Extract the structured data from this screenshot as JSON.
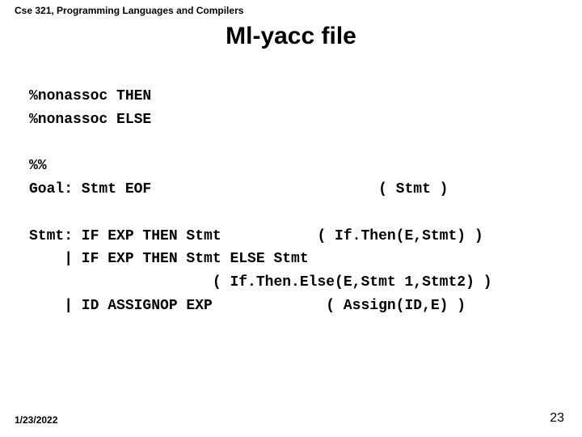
{
  "header": "Cse 321, Programming Languages and Compilers",
  "title": "Ml-yacc file",
  "code": {
    "l1": "%nonassoc THEN",
    "l2": "%nonassoc ELSE",
    "l3": "",
    "l4": "%%",
    "l5": "Goal: Stmt EOF                          ( Stmt )",
    "l6": "",
    "l7": "Stmt: IF EXP THEN Stmt           ( If.Then(E,Stmt) )",
    "l8": "    | IF EXP THEN Stmt ELSE Stmt",
    "l9": "                     ( If.Then.Else(E,Stmt 1,Stmt2) )",
    "l10": "    | ID ASSIGNOP EXP             ( Assign(ID,E) )"
  },
  "footer": {
    "date": "1/23/2022",
    "page": "23"
  }
}
